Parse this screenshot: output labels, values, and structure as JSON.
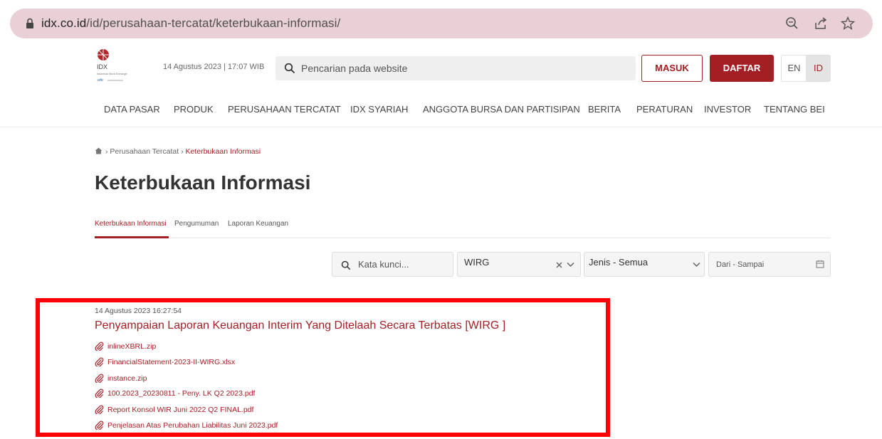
{
  "browser": {
    "url_host": "idx.co.id",
    "url_path": "/id/perusahaan-tercatat/keterbukaan-informasi/",
    "icons": [
      "lock-icon",
      "zoom-icon",
      "share-icon",
      "star-icon"
    ]
  },
  "header": {
    "logo_text": "IDX",
    "logo_sub": "Indonesia Stock Exchange",
    "datetime": "14 Agustus 2023  |  17:07 WIB",
    "search_placeholder": "Pencarian pada website",
    "login_label": "MASUK",
    "register_label": "DAFTAR",
    "lang_en": "EN",
    "lang_id": "ID"
  },
  "nav": [
    "DATA PASAR",
    "PRODUK",
    "PERUSAHAAN TERCATAT",
    "IDX SYARIAH",
    "ANGGOTA BURSA DAN PARTISIPAN",
    "BERITA",
    "PERATURAN",
    "INVESTOR",
    "TENTANG BEI"
  ],
  "breadcrumb": {
    "parent": "Perusahaan Tercatat",
    "current": "Keterbukaan Informasi"
  },
  "page_title": "Keterbukaan Informasi",
  "tabs": [
    "Keterbukaan Informasi",
    "Pengumuman",
    "Laporan Keuangan"
  ],
  "filters": {
    "keyword_placeholder": "Kata kunci...",
    "company_value": "WIRG",
    "type_value": "Jenis - Semua",
    "date_placeholder": "Dari - Sampai"
  },
  "announcement": {
    "timestamp": "14 Agustus 2023 16:27:54",
    "title": "Penyampaian Laporan Keuangan Interim Yang Ditelaah Secara Terbatas [WIRG ]",
    "attachments": [
      "inlineXBRL.zip",
      "FinancialStatement-2023-II-WIRG.xlsx",
      "instance.zip",
      "100.2023_20230811 - Peny. LK Q2 2023.pdf",
      "Report Konsol WIR Juni 2022 Q2 FINAL.pdf",
      "Penjelasan Atas Perubahan Liabilitas Juni 2023.pdf"
    ]
  },
  "colors": {
    "brand": "#a31f24",
    "url_bar": "#e9cfd6",
    "highlight": "#ff0000"
  }
}
